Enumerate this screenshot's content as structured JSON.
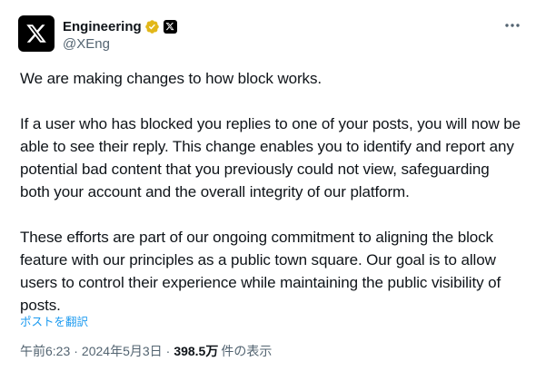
{
  "author": {
    "display_name": "Engineering",
    "handle": "@XEng",
    "avatar_icon": "x-logo-icon",
    "verified_badge_color": "#e2b719",
    "affiliate_badge_icon": "x-logo-icon"
  },
  "tweet": {
    "paragraphs": [
      "We are making changes to how block works.",
      "If a user who has blocked you replies to one of your posts, you will now be able to see their reply. This change enables you to identify and report any potential bad content that you previously could not view, safeguarding both your account and the overall integrity of our platform.",
      "These efforts are part of our ongoing commitment to aligning the block feature with our principles as a public town square. Our goal is to allow users to control their experience while maintaining the public visibility of posts."
    ],
    "translate_label": "ポストを翻訳"
  },
  "meta": {
    "time": "午前6:23",
    "separator": "·",
    "date": "2024年5月3日",
    "views_count": "398.5万",
    "views_label": "件の表示"
  },
  "colors": {
    "text_primary": "#0f1419",
    "text_secondary": "#536471",
    "link": "#1d9bf0"
  }
}
